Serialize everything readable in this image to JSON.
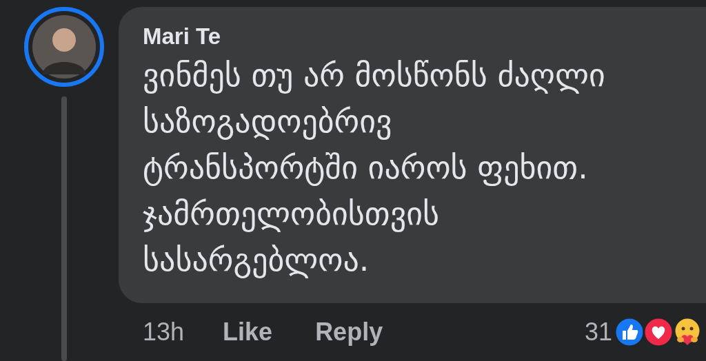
{
  "comment": {
    "author": "Mari Te",
    "body_lines": [
      "ვინმეს თუ არ მოსწონს ძაღლი",
      "საზოგადოებრივ",
      "ტრანსპორტში იაროს ფეხით.",
      "ჯამრთელობისთვის",
      "სასარგებლოა."
    ],
    "time": "13h",
    "actions": [
      "Like",
      "Reply"
    ],
    "reaction_count": "31",
    "reactions": [
      {
        "kind": "like"
      },
      {
        "kind": "love"
      },
      {
        "kind": "care"
      }
    ]
  }
}
